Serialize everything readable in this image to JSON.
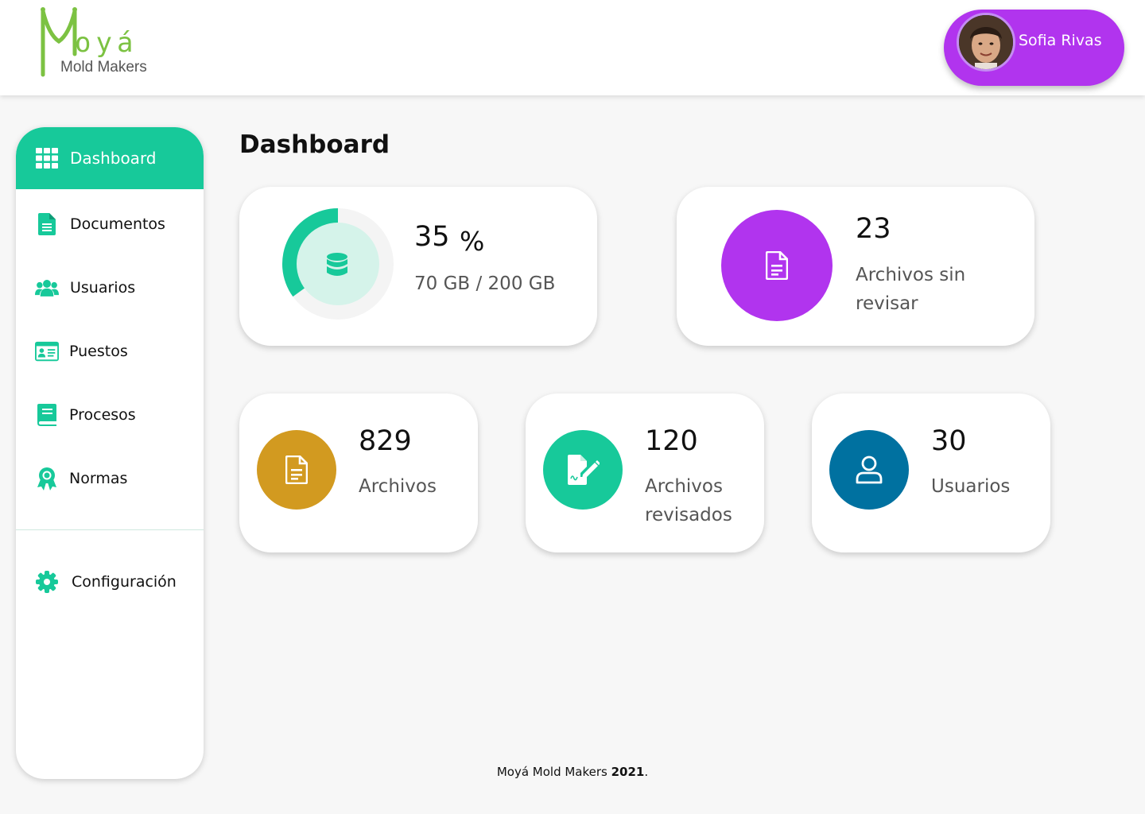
{
  "header": {
    "logo_brand": "oyá",
    "logo_sub": "Mold Makers",
    "user_name": "Sofia Rivas",
    "user_color": "#b134ee"
  },
  "sidebar": {
    "items": [
      {
        "label": "Dashboard",
        "icon": "grid-icon",
        "active": true
      },
      {
        "label": "Documentos",
        "icon": "document-icon"
      },
      {
        "label": "Usuarios",
        "icon": "users-icon"
      },
      {
        "label": "Puestos",
        "icon": "id-card-icon"
      },
      {
        "label": "Procesos",
        "icon": "book-icon"
      },
      {
        "label": "Normas",
        "icon": "award-icon"
      }
    ],
    "settings": {
      "label": "Configuración",
      "icon": "gear-icon"
    },
    "accent": "#17c99a"
  },
  "main": {
    "title": "Dashboard",
    "storage": {
      "percent_value": "35",
      "percent_sign": "%",
      "detail": "70 GB / 200 GB",
      "fraction": 0.35
    },
    "unreviewed": {
      "count": "23",
      "label": "Archivos sin revisar",
      "color": "#b134ee"
    },
    "files": {
      "count": "829",
      "label": "Archivos",
      "color": "#d29a20"
    },
    "reviewed": {
      "count": "120",
      "label": "Archivos revisados",
      "color": "#17c99a"
    },
    "users": {
      "count": "30",
      "label": "Usuarios",
      "color": "#0071a0"
    }
  },
  "footer": {
    "text": "Moyá Mold Makers ",
    "year": "2021",
    "suffix": "."
  }
}
